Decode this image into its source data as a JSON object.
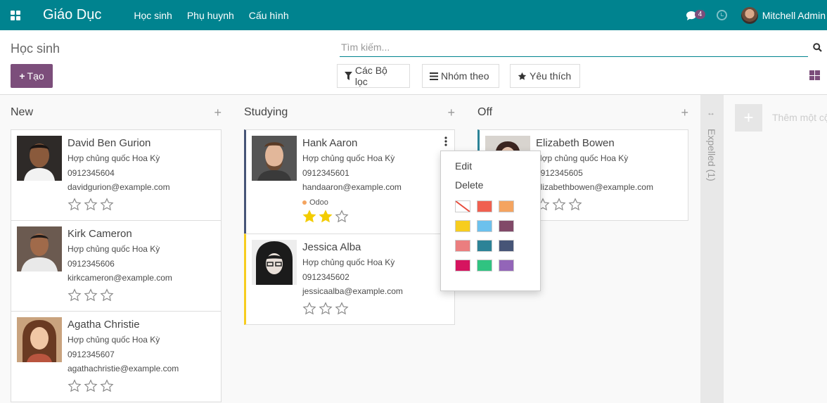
{
  "navbar": {
    "brand": "Giáo Dục",
    "menu": [
      "Học sinh",
      "Phụ huynh",
      "Cấu hình"
    ],
    "chat_count": "4",
    "user": "Mitchell Admin"
  },
  "control": {
    "title": "Học sinh",
    "create_label": "Tạo",
    "search_placeholder": "Tìm kiếm...",
    "filters_label": "Các Bộ lọc",
    "group_label": "Nhóm theo",
    "favorites_label": "Yêu thích"
  },
  "columns": [
    {
      "title": "New",
      "cards": [
        {
          "name": "David Ben Gurion",
          "country": "Hợp chủng quốc Hoa Kỳ",
          "phone": "0912345604",
          "email": "davidgurion@example.com",
          "stars": 0
        },
        {
          "name": "Kirk Cameron",
          "country": "Hợp chủng quốc Hoa Kỳ",
          "phone": "0912345606",
          "email": "kirkcameron@example.com",
          "stars": 0
        },
        {
          "name": "Agatha Christie",
          "country": "Hợp chủng quốc Hoa Kỳ",
          "phone": "0912345607",
          "email": "agathachristie@example.com",
          "stars": 0
        }
      ]
    },
    {
      "title": "Studying",
      "cards": [
        {
          "name": "Hank Aaron",
          "country": "Hợp chủng quốc Hoa Kỳ",
          "phone": "0912345601",
          "email": "handaaron@example.com",
          "tag": "Odoo",
          "stars": 2
        },
        {
          "name": "Jessica Alba",
          "country": "Hợp chủng quốc Hoa Kỳ",
          "phone": "0912345602",
          "email": "jessicaalba@example.com",
          "stars": 0
        }
      ]
    },
    {
      "title": "Off",
      "cards": [
        {
          "name": "Elizabeth Bowen",
          "country": "Hợp chủng quốc Hoa Kỳ",
          "phone": "0912345605",
          "email": "elizabethbowen@example.com",
          "stars": 0
        }
      ]
    }
  ],
  "folded_column": "Expelled (1)",
  "add_column_label": "Thêm một cột",
  "dropdown": {
    "edit": "Edit",
    "delete": "Delete",
    "colors": [
      "#ffffff",
      "#f06050",
      "#f4a460",
      "#f7cd1f",
      "#6cc1ed",
      "#814968",
      "#eb7e7f",
      "#2c8397",
      "#475577",
      "#d6145f",
      "#30c381",
      "#9365b8"
    ]
  },
  "colors": {
    "primary": "#00838f",
    "accent": "#7c4e7b",
    "star_on": "#f3cc00"
  }
}
